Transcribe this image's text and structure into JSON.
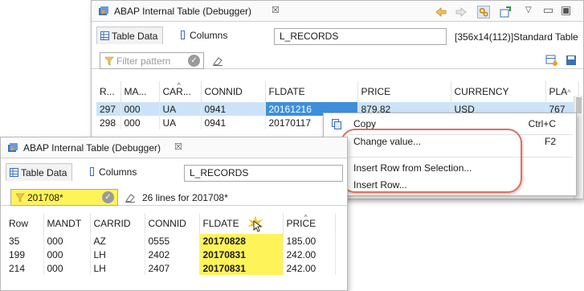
{
  "back_window": {
    "title": "ABAP Internal Table (Debugger)",
    "close_glyph": "☒",
    "tabs": [
      {
        "label": "Table Data"
      },
      {
        "label": "Columns"
      }
    ],
    "table_name": "L_RECORDS",
    "table_info": "[356x14(112)]Standard Table",
    "filter_placeholder": "Filter pattern",
    "columns": [
      "R...",
      "MA...",
      "CAR...",
      "CONNID",
      "FLDATE",
      "PRICE",
      "CURRENCY",
      "PLA"
    ],
    "rows": [
      [
        "297",
        "000",
        "UA",
        "0941",
        "20161216",
        "879.82",
        "USD",
        "767"
      ],
      [
        "298",
        "000",
        "UA",
        "0941",
        "20170117",
        "",
        "",
        ""
      ]
    ]
  },
  "context_menu": {
    "items": [
      {
        "label": "Copy",
        "shortcut": "Ctrl+C",
        "icon": "copy-icon"
      },
      {
        "label": "Change value...",
        "shortcut": "F2"
      },
      {
        "label": "Insert Row from Selection..."
      },
      {
        "label": "Insert Row..."
      }
    ]
  },
  "front_window": {
    "title": "ABAP Internal Table (Debugger)",
    "close_glyph": "☒",
    "tabs": [
      {
        "label": "Table Data"
      },
      {
        "label": "Columns"
      }
    ],
    "table_name": "L_RECORDS",
    "filter_value": "201708*",
    "lines_text": "26 lines for 201708*",
    "columns": [
      "Row",
      "MANDT",
      "CARRID",
      "CONNID",
      "FLDATE",
      "PRICE"
    ],
    "rows": [
      [
        "35",
        "000",
        "AZ",
        "0555",
        "20170828",
        "185.00"
      ],
      [
        "199",
        "000",
        "LH",
        "2402",
        "20170831",
        "242.00"
      ],
      [
        "214",
        "000",
        "LH",
        "2407",
        "20170831",
        "242.00"
      ]
    ]
  },
  "colors": {
    "highlight": "#fff35a",
    "selection": "#3d8fdb",
    "callout": "#d8725e"
  }
}
